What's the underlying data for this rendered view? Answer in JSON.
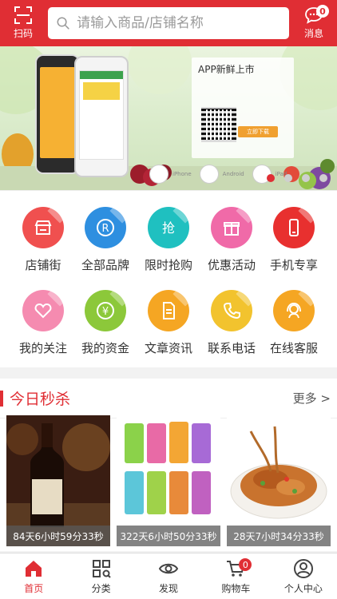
{
  "header": {
    "scan_label": "扫码",
    "search_placeholder": "请输入商品/店铺名称",
    "message_label": "消息",
    "message_badge": "0"
  },
  "banner": {
    "card_title": "APP新鲜上市",
    "download_button": "立即下载",
    "platforms": [
      "iPhone",
      "Android",
      "iPad"
    ],
    "active_slide": 1,
    "slide_count": 4
  },
  "grid": {
    "items": [
      {
        "label": "店铺街",
        "icon": "store-icon",
        "color": "#f0504f"
      },
      {
        "label": "全部品牌",
        "icon": "registered-icon",
        "color": "#2e8fe0"
      },
      {
        "label": "限时抢购",
        "icon": "grab-icon",
        "color": "#1fc0c0"
      },
      {
        "label": "优惠活动",
        "icon": "gift-icon",
        "color": "#f06aa8"
      },
      {
        "label": "手机专享",
        "icon": "phone-icon",
        "color": "#e8302f"
      },
      {
        "label": "我的关注",
        "icon": "heart-icon",
        "color": "#f58bb0"
      },
      {
        "label": "我的资金",
        "icon": "yen-icon",
        "color": "#8cc83a"
      },
      {
        "label": "文章资讯",
        "icon": "document-icon",
        "color": "#f5a623"
      },
      {
        "label": "联系电话",
        "icon": "telephone-icon",
        "color": "#f2c32e"
      },
      {
        "label": "在线客服",
        "icon": "headset-icon",
        "color": "#f5a623"
      }
    ]
  },
  "flash_sale": {
    "title": "今日秒杀",
    "more_label": "更多 >",
    "products": [
      {
        "timer": "84天6小时59分33秒",
        "image": "wine-bottle"
      },
      {
        "timer": "322天6小时50分33秒",
        "image": "rio-cocktail-cans"
      },
      {
        "timer": "28天7小时34分33秒",
        "image": "noodle-dish"
      }
    ]
  },
  "tabbar": {
    "items": [
      {
        "label": "首页",
        "icon": "home-icon",
        "active": true
      },
      {
        "label": "分类",
        "icon": "category-icon",
        "active": false
      },
      {
        "label": "发现",
        "icon": "eye-icon",
        "active": false
      },
      {
        "label": "购物车",
        "icon": "cart-icon",
        "active": false,
        "badge": "0"
      },
      {
        "label": "个人中心",
        "icon": "user-icon",
        "active": false
      }
    ]
  },
  "colors": {
    "brand_red": "#e02e34",
    "text": "#333333"
  }
}
